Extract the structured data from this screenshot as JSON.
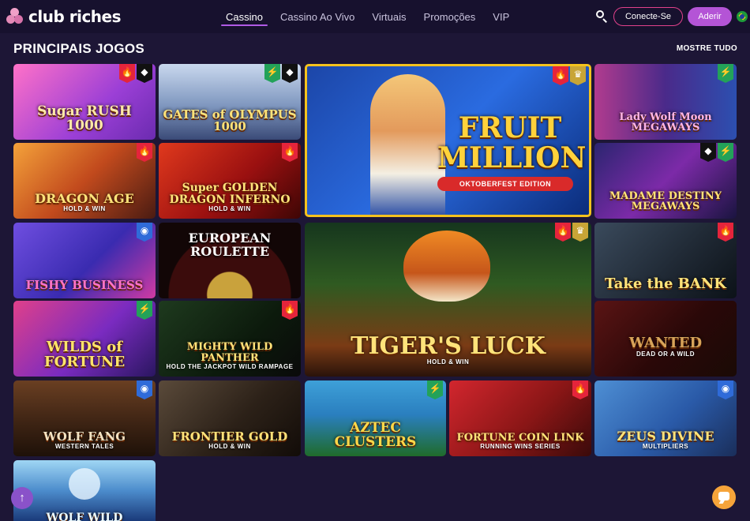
{
  "header": {
    "brand": "club riches",
    "nav": [
      {
        "label": "Cassino",
        "active": true
      },
      {
        "label": "Cassino Ao Vivo",
        "active": false
      },
      {
        "label": "Virtuais",
        "active": false
      },
      {
        "label": "Promoções",
        "active": false
      },
      {
        "label": "VIP",
        "active": false
      }
    ],
    "login_label": "Conecte-Se",
    "join_label": "Aderir",
    "language_flag": "brazil-flag-icon"
  },
  "section": {
    "title": "PRINCIPAIS JOGOS",
    "see_all": "MOSTRE TUDO"
  },
  "games": [
    {
      "title": "Sugar Rush 1000",
      "art_text": "Sugar RUSH 1000",
      "sub": "",
      "badges": [
        "hot",
        "provider"
      ]
    },
    {
      "title": "Gates of Olympus 1000",
      "art_text": "GATES of OLYMPUS 1000",
      "sub": "",
      "badges": [
        "new",
        "provider"
      ]
    },
    {
      "title": "Fruit Million",
      "art_text": "FRUIT MILLION",
      "sub": "OKTOBERFEST EDITION",
      "badges": [
        "hot",
        "top"
      ]
    },
    {
      "title": "Lady Wolf Moon Megaways",
      "art_text": "Lady Wolf Moon MEGAWAYS",
      "sub": "",
      "badges": [
        "new"
      ]
    },
    {
      "title": "Dragon Age Hold & Win",
      "art_text": "DRAGON AGE",
      "sub": "HOLD & WIN",
      "badges": [
        "hot"
      ]
    },
    {
      "title": "Super Golden Dragon Inferno",
      "art_text": "Super GOLDEN DRAGON INFERNO",
      "sub": "HOLD & WIN",
      "badges": [
        "hot"
      ]
    },
    {
      "title": "Madame Destiny Megaways",
      "art_text": "MADAME DESTINY MEGAWAYS",
      "sub": "",
      "badges": [
        "provider",
        "new"
      ]
    },
    {
      "title": "Fishy Business",
      "art_text": "FISHY BUSINESS",
      "sub": "",
      "badges": [
        "drop"
      ]
    },
    {
      "title": "European Roulette",
      "art_text": "EUROPEAN ROULETTE",
      "sub": "",
      "badges": []
    },
    {
      "title": "Tiger's Luck",
      "art_text": "TIGER'S LUCK",
      "sub": "HOLD & WIN",
      "badges": [
        "hot",
        "top"
      ]
    },
    {
      "title": "Take the Bank",
      "art_text": "Take the BANK",
      "sub": "",
      "badges": [
        "hot"
      ]
    },
    {
      "title": "Wilds of Fortune",
      "art_text": "WILDS of FORTUNE",
      "sub": "",
      "badges": [
        "new"
      ]
    },
    {
      "title": "Mighty Wild Panther",
      "art_text": "MIGHTY WILD PANTHER",
      "sub": "HOLD THE JACKPOT WILD RAMPAGE",
      "badges": [
        "hot"
      ]
    },
    {
      "title": "Wanted Dead or a Wild",
      "art_text": "WANTED",
      "sub": "DEAD OR A WILD",
      "badges": []
    },
    {
      "title": "Wolf Fang Western Tales",
      "art_text": "WOLF FANG",
      "sub": "WESTERN TALES",
      "badges": [
        "drop"
      ]
    },
    {
      "title": "Frontier Gold",
      "art_text": "FRONTIER GOLD",
      "sub": "HOLD & WIN",
      "badges": []
    },
    {
      "title": "Aztec Clusters",
      "art_text": "AZTEC CLUSTERS",
      "sub": "",
      "badges": [
        "new"
      ]
    },
    {
      "title": "Fortune Coin Link",
      "art_text": "FORTUNE COIN LINK",
      "sub": "RUNNING WINS SERIES",
      "badges": [
        "hot"
      ]
    },
    {
      "title": "Zeus vs Divine Multipliers",
      "art_text": "ZEUS DIVINE",
      "sub": "MULTIPLIERS",
      "badges": [
        "drop"
      ]
    },
    {
      "title": "Wolf Wild",
      "art_text": "WOLF WILD",
      "sub": "",
      "badges": []
    }
  ],
  "badge_icons": {
    "hot": "flame-icon",
    "new": "lightning-icon",
    "drop": "drop-icon",
    "top": "trophy-icon",
    "provider": "provider-logo-icon"
  },
  "colors": {
    "accent": "#b454d6",
    "login_border": "#e2418b",
    "background": "#1d1636",
    "header": "#17112e",
    "chat": "#f6a43a"
  }
}
